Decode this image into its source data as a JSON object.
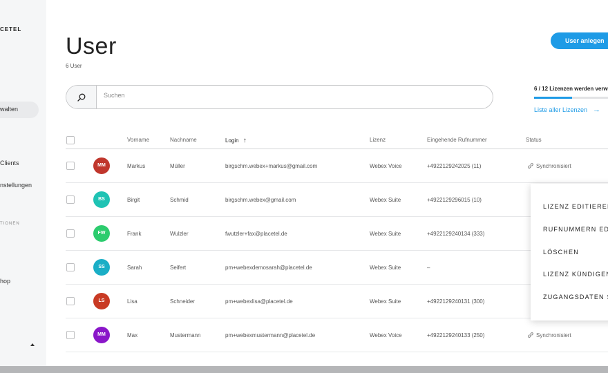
{
  "sidebar": {
    "logo": "CETEL",
    "items": [
      {
        "label": "walten",
        "active": true
      },
      {
        "label": "Clients"
      },
      {
        "label": "nstellungen"
      },
      {
        "label": "hop"
      }
    ],
    "section_label": "TIONEN"
  },
  "header": {
    "title": "User",
    "count": "6 User",
    "add_button": "User anlegen"
  },
  "search": {
    "placeholder": "Suchen",
    "value": ""
  },
  "licenses": {
    "summary": "6 / 12 Lizenzen werden verw",
    "used_fraction": 0.5,
    "link": "Liste aller Lizenzen",
    "link_arrow": "→"
  },
  "table": {
    "headers": {
      "vorname": "Vorname",
      "nachname": "Nachname",
      "login": "Login",
      "login_sort": "↑",
      "lizenz": "Lizenz",
      "rufnummer": "Eingehende Rufnummer",
      "status": "Status"
    },
    "rows": [
      {
        "initials": "MM",
        "color": "#c0362c",
        "vorname": "Markus",
        "nachname": "Müller",
        "login": "birgschm.webex+markus@gmail.com",
        "lizenz": "Webex Voice",
        "rufnummer": "+4922129242025 (11)",
        "status": "Synchronisiert"
      },
      {
        "initials": "BS",
        "color": "#1fc3b4",
        "vorname": "Birgit",
        "nachname": "Schmid",
        "login": "birgschm.webex@gmail.com",
        "lizenz": "Webex Suite",
        "rufnummer": "+4922129296015 (10)",
        "status": ""
      },
      {
        "initials": "FW",
        "color": "#2ccc6e",
        "vorname": "Frank",
        "nachname": "Wulzler",
        "login": "fwutzler+fax@placetel.de",
        "lizenz": "Webex Suite",
        "rufnummer": "+4922129240134 (333)",
        "status": ""
      },
      {
        "initials": "SS",
        "color": "#1aaec6",
        "vorname": "Sarah",
        "nachname": "Seifert",
        "login": "pm+webexdemosarah@placetel.de",
        "lizenz": "Webex Suite",
        "rufnummer": "–",
        "status": ""
      },
      {
        "initials": "LS",
        "color": "#c93a24",
        "vorname": "Lisa",
        "nachname": "Schneider",
        "login": "pm+webexlisa@placetel.de",
        "lizenz": "Webex Suite",
        "rufnummer": "+4922129240131 (300)",
        "status": ""
      },
      {
        "initials": "MM",
        "color": "#8a16c9",
        "vorname": "Max",
        "nachname": "Mustermann",
        "login": "pm+webexmustermann@placetel.de",
        "lizenz": "Webex Voice",
        "rufnummer": "+4922129240133 (250)",
        "status": "Synchronisiert"
      }
    ]
  },
  "context_menu": {
    "items": [
      "LIZENZ EDITIEREN",
      "RUFNUMMERN EDI",
      "LÖSCHEN",
      "LIZENZ KÜNDIGEN",
      "ZUGANGSDATEN S"
    ]
  },
  "colors": {
    "accent": "#1e9be6",
    "sidebar_bg": "#f5f6f7"
  }
}
